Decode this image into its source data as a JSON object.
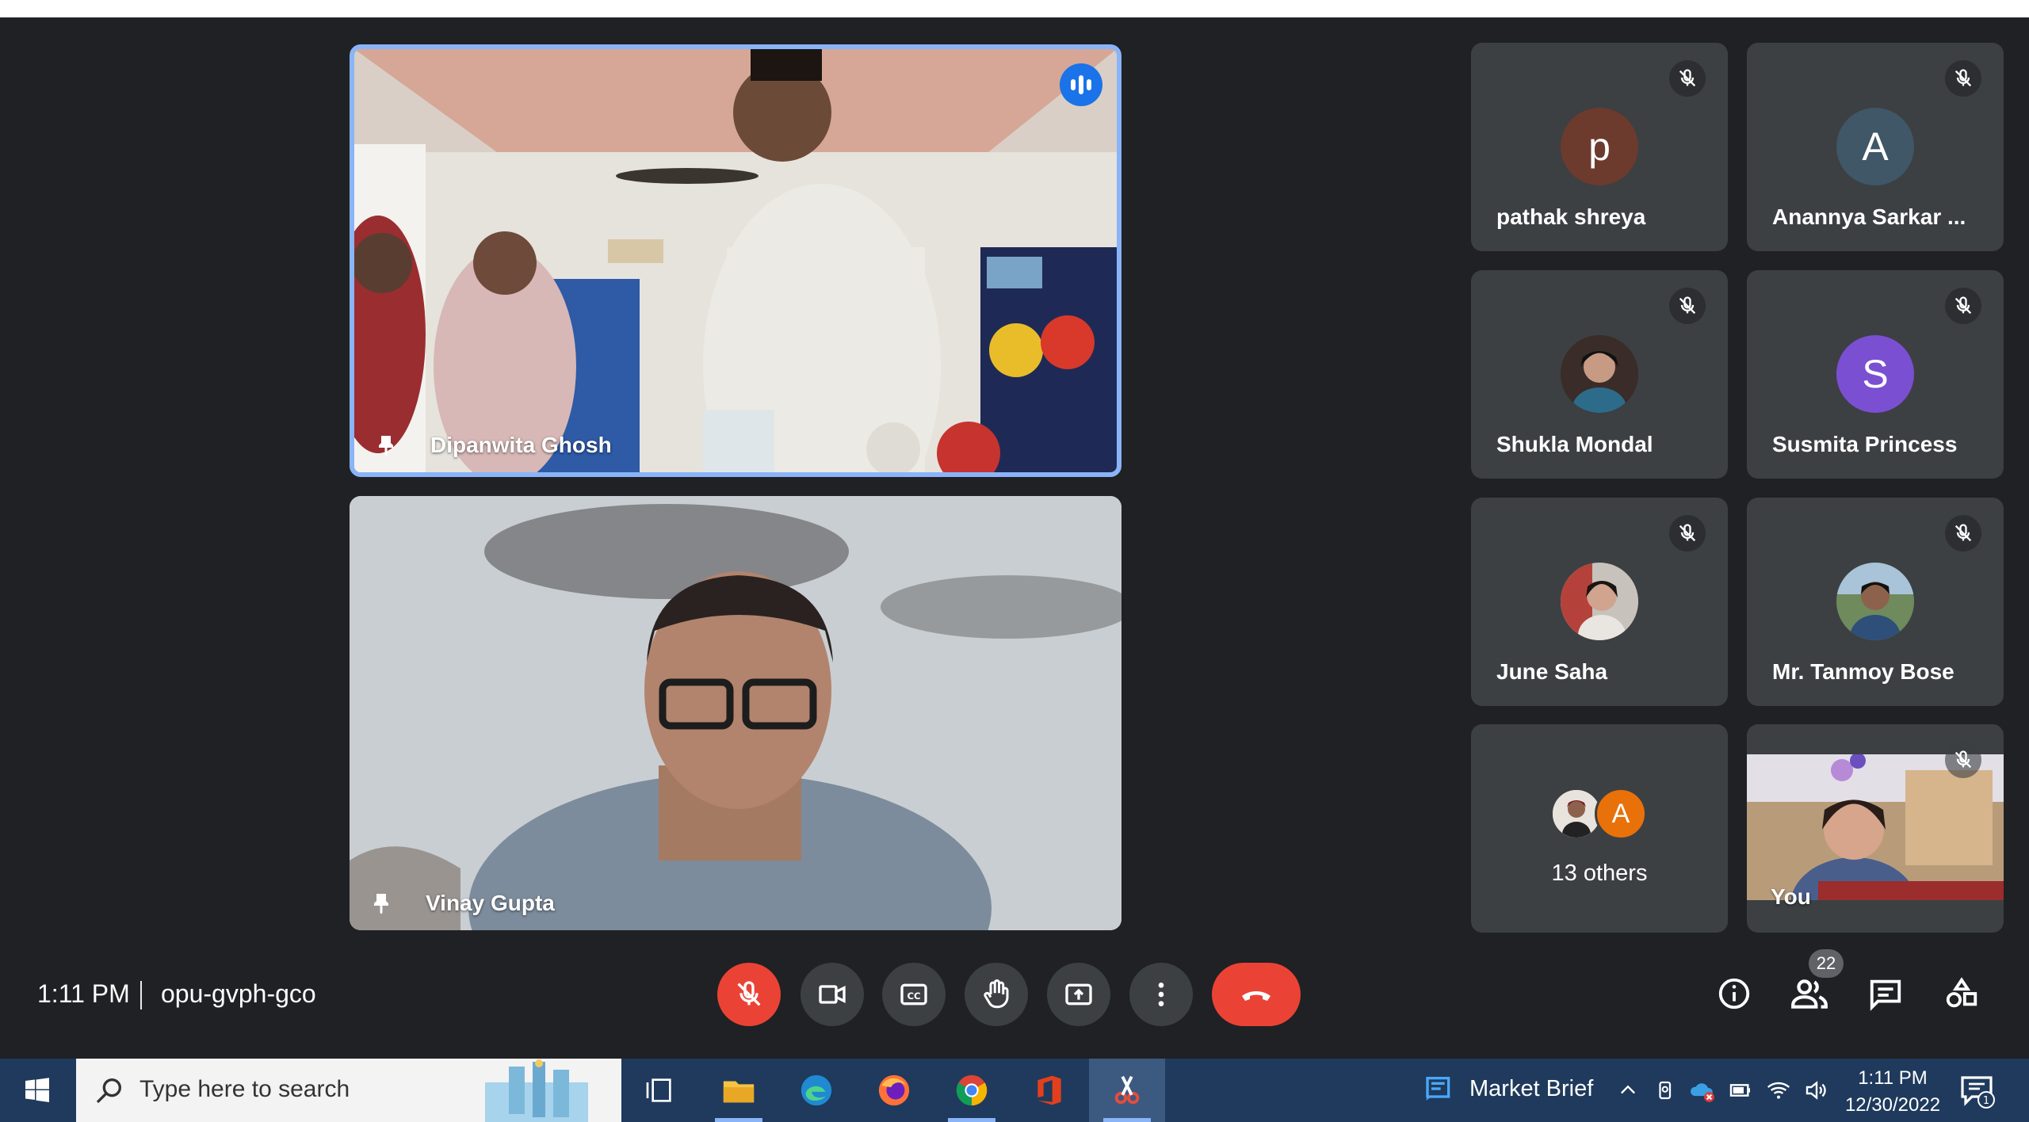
{
  "meeting": {
    "time": "1:11 PM",
    "code": "opu-gvph-gco"
  },
  "main_tiles": [
    {
      "name": "Dipanwita Ghosh"
    },
    {
      "name": "Vinay Gupta"
    }
  ],
  "participants": [
    {
      "name": "pathak shreya",
      "initial": "p",
      "color": "#6d3a2e"
    },
    {
      "name": "Anannya Sarkar ...",
      "initial": "A",
      "color": "#3f5766"
    },
    {
      "name": "Shukla Mondal",
      "initial": "",
      "color": "#2b2b2b"
    },
    {
      "name": "Susmita Princess",
      "initial": "S",
      "color": "#7b4fd1"
    },
    {
      "name": "June Saha",
      "initial": "",
      "color": "#9a6b5a"
    },
    {
      "name": "Mr. Tanmoy Bose",
      "initial": "",
      "color": "#4a6d8c"
    }
  ],
  "others": {
    "initial": "A",
    "label": "13 others"
  },
  "self_tile": {
    "name": "You"
  },
  "controls": {
    "participants_count": "22"
  },
  "taskbar": {
    "search_placeholder": "Type here to search",
    "widget_label": "Market Brief",
    "time": "1:11 PM",
    "date": "12/30/2022",
    "notification_count": "1"
  }
}
